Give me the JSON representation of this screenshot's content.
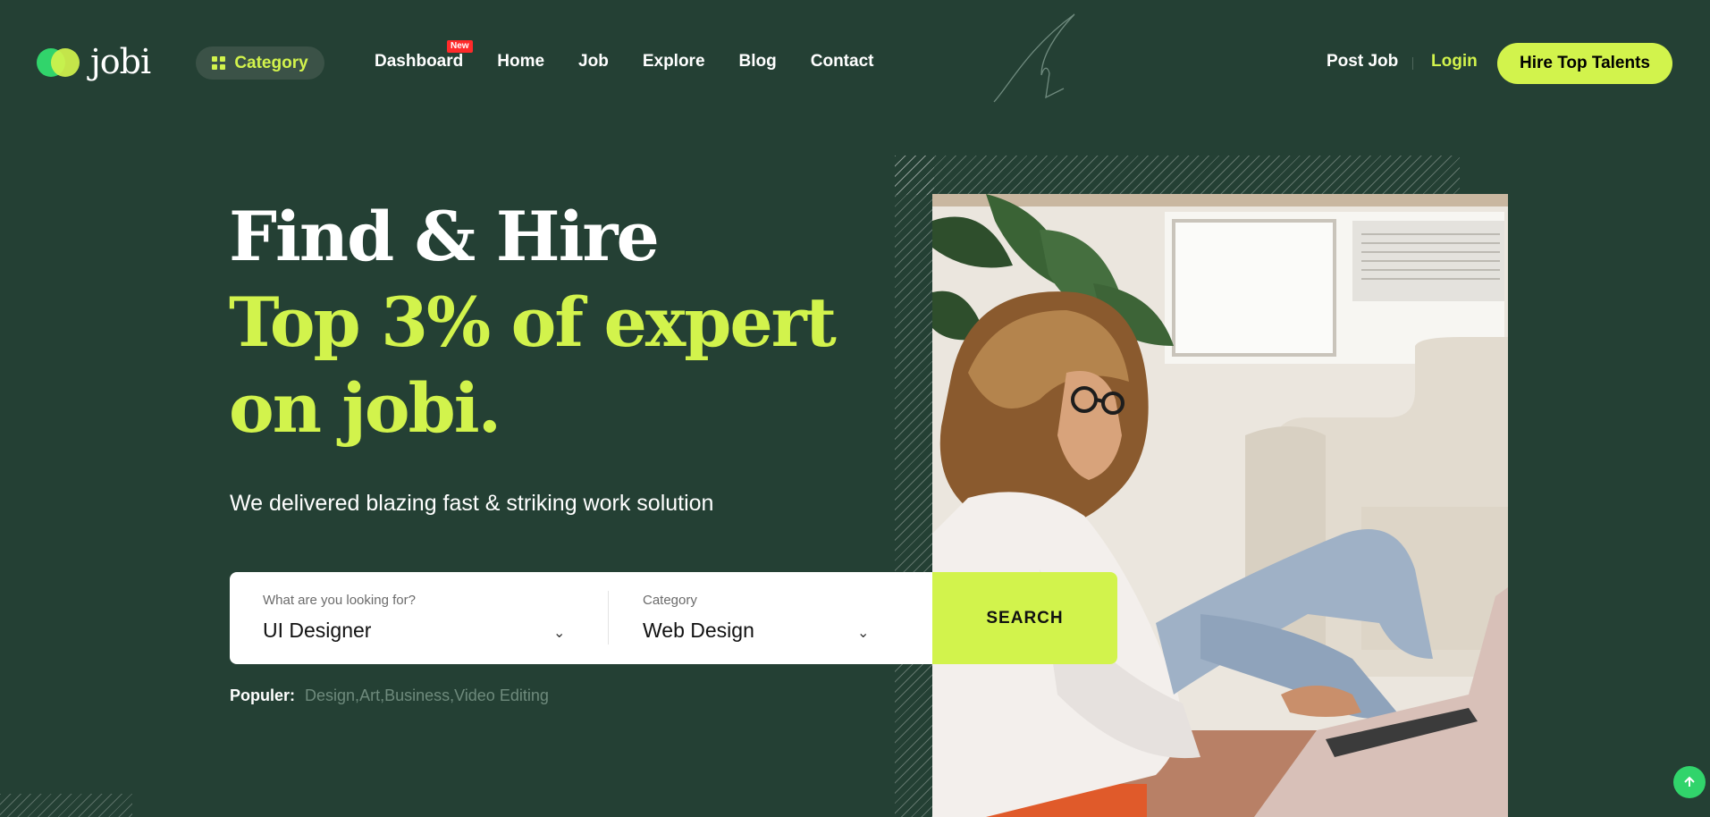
{
  "header": {
    "logo_text": "jobi",
    "category_label": "Category",
    "nav": [
      {
        "label": "Dashboard",
        "badge": "New"
      },
      {
        "label": "Home"
      },
      {
        "label": "Job"
      },
      {
        "label": "Explore"
      },
      {
        "label": "Blog"
      },
      {
        "label": "Contact"
      }
    ],
    "post_job": "Post Job",
    "login": "Login",
    "hire_button": "Hire Top Talents"
  },
  "hero": {
    "title_line1": "Find & Hire",
    "title_line2": "Top 3% of expert",
    "title_line3": "on jobi.",
    "subtitle": "We delivered blazing fast & striking work solution"
  },
  "search": {
    "what_label": "What are you looking for?",
    "what_value": "UI Designer",
    "category_label": "Category",
    "category_value": "Web Design",
    "button": "SEARCH"
  },
  "popular": {
    "label": "Populer:",
    "values": "Design,Art,Business,Video Editing"
  },
  "colors": {
    "background": "#244034",
    "accent": "#d2f34c",
    "green": "#31d46b",
    "badge": "#ff2a2a"
  },
  "icons": [
    "grid-icon",
    "chevron-down-icon",
    "arrow-up-icon"
  ]
}
